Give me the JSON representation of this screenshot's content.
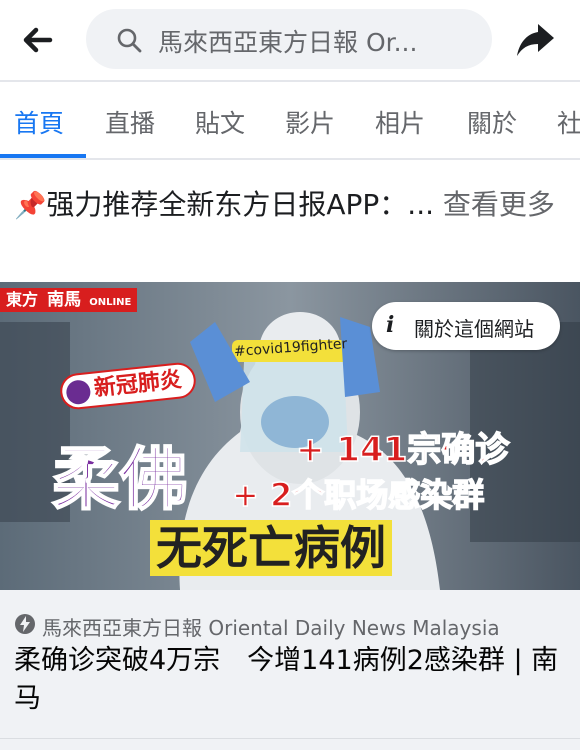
{
  "header": {
    "search_text": "馬來西亞東方日報 Or...",
    "back_icon": "arrow-left-icon",
    "search_icon": "search-icon",
    "share_icon": "share-arrow-icon"
  },
  "tabs": [
    {
      "label": "首頁",
      "active": true
    },
    {
      "label": "直播",
      "active": false
    },
    {
      "label": "貼文",
      "active": false
    },
    {
      "label": "影片",
      "active": false
    },
    {
      "label": "相片",
      "active": false
    },
    {
      "label": "關於",
      "active": false
    },
    {
      "label": "社",
      "active": false
    }
  ],
  "post": {
    "pin_icon": "📌",
    "text": "强力推荐全新东方日报APP：... ",
    "see_more": "查看更多"
  },
  "ad_image": {
    "brand": "東方",
    "brand_region": "南馬",
    "brand_online": "ONLINE",
    "tag": "新冠肺炎",
    "headband": "#covid19fighter",
    "place": "柔佛",
    "line1": "+ 141宗确诊",
    "line2": "+ 2个职场感染群",
    "line3": "无死亡病例",
    "about_button": "關於這個網站",
    "about_icon": "i"
  },
  "link_card": {
    "source": "馬來西亞東方日報 Oriental Daily News Malaysia",
    "headline": "柔确诊突破4万宗　今增141病例2感染群 | 南马"
  },
  "colors": {
    "accent": "#1877f2",
    "muted": "#65676b",
    "card_bg": "#f0f2f5",
    "ad_red": "#d81e1e",
    "ad_purple": "#6a2c91",
    "ad_yellow": "#f3e03a"
  }
}
